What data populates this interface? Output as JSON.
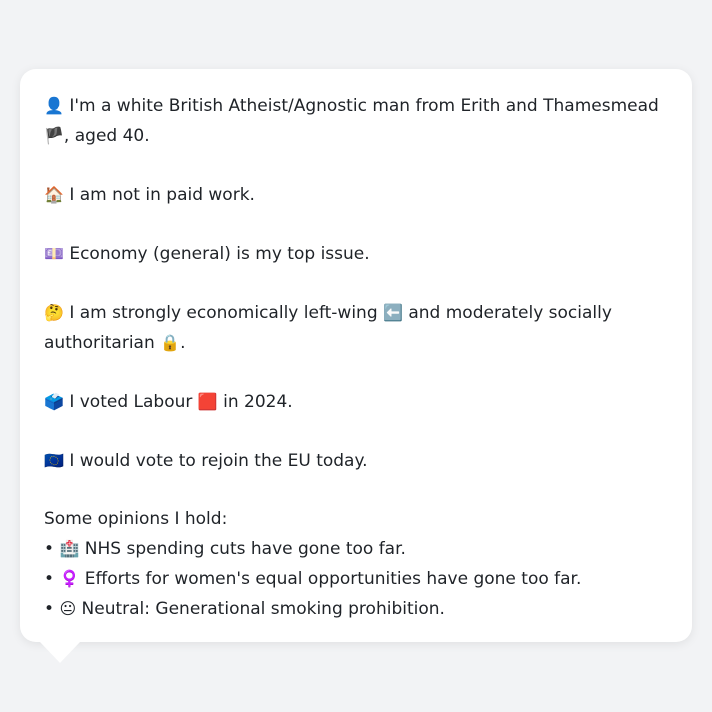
{
  "bio": {
    "p1": {
      "icon": "👤",
      "text_a": "I'm a white British Atheist/Agnostic man from Erith and Thamesmead",
      "flag": "🏴",
      "text_b": ", aged 40."
    },
    "p2": {
      "icon": "🏠",
      "text": "I am not in paid work."
    },
    "p3": {
      "icon": "💷",
      "text": "Economy (general) is my top issue."
    },
    "p4": {
      "icon": "🤔",
      "text_a": "I am strongly economically left-wing",
      "icon2": "⬅️",
      "text_b": "and moderately socially authoritarian",
      "icon3": "🔒",
      "text_c": "."
    },
    "p5": {
      "icon": "🗳️",
      "text_a": "I voted Labour",
      "icon2": "🟥",
      "text_b": "in 2024."
    },
    "p6": {
      "icon": "🇪🇺",
      "text": "I would vote to rejoin the EU today."
    },
    "opinions": {
      "heading": "Some opinions I hold:",
      "items": [
        {
          "bullet": "•",
          "icon": "🏥",
          "text": "NHS spending cuts have gone too far."
        },
        {
          "bullet": "•",
          "icon": "♀️",
          "text": "Efforts for women's equal opportunities have gone too far."
        },
        {
          "bullet": "•",
          "icon": "😐",
          "text": "Neutral: Generational smoking prohibition."
        }
      ]
    }
  },
  "colors": {
    "background": "#f2f3f5",
    "bubble": "#ffffff",
    "text": "#1f2328"
  }
}
